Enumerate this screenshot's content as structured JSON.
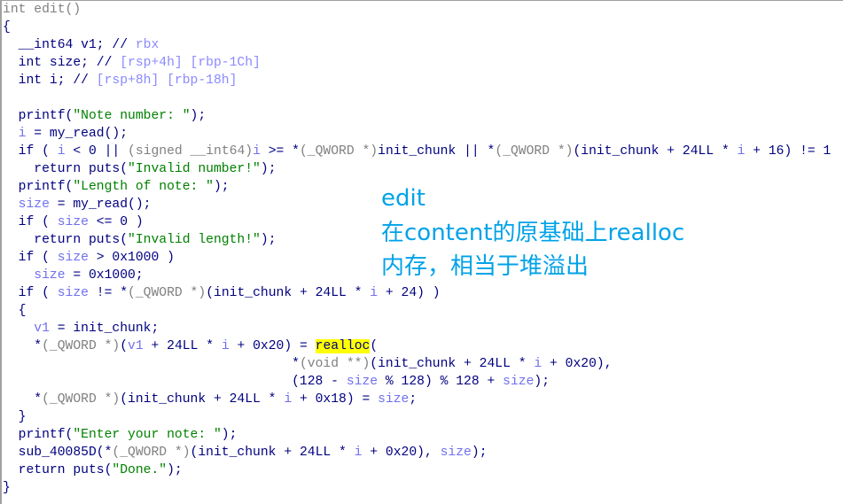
{
  "code_lines": [
    [
      [
        "g",
        "int edit()"
      ]
    ],
    [
      [
        "k",
        "{"
      ]
    ],
    [
      [
        "k",
        "  __int64 v1; // "
      ],
      [
        "c",
        "rbx"
      ]
    ],
    [
      [
        "k",
        "  int size; // "
      ],
      [
        "c",
        "[rsp+4h] [rbp-1Ch]"
      ]
    ],
    [
      [
        "k",
        "  int i; // "
      ],
      [
        "c",
        "[rsp+8h] [rbp-18h]"
      ]
    ],
    [],
    [
      [
        "k",
        "  printf("
      ],
      [
        "s",
        "\"Note number: \""
      ],
      [
        "k",
        ");"
      ]
    ],
    [
      [
        "k",
        "  "
      ],
      [
        "v",
        "i"
      ],
      [
        "k",
        " = my_read();"
      ]
    ],
    [
      [
        "k",
        "  if ( "
      ],
      [
        "v",
        "i"
      ],
      [
        "k",
        " < 0 || "
      ],
      [
        "g",
        "(signed __int64)"
      ],
      [
        "v",
        "i"
      ],
      [
        "k",
        " >= *"
      ],
      [
        "g",
        "(_QWORD *)"
      ],
      [
        "k",
        "init_chunk || *"
      ],
      [
        "g",
        "(_QWORD *)"
      ],
      [
        "k",
        "(init_chunk + 24LL * "
      ],
      [
        "v",
        "i"
      ],
      [
        "k",
        " + 16) != 1"
      ]
    ],
    [
      [
        "k",
        "    return puts("
      ],
      [
        "s",
        "\"Invalid number!\""
      ],
      [
        "k",
        ");"
      ]
    ],
    [
      [
        "k",
        "  printf("
      ],
      [
        "s",
        "\"Length of note: \""
      ],
      [
        "k",
        ");"
      ]
    ],
    [
      [
        "k",
        "  "
      ],
      [
        "v",
        "size"
      ],
      [
        "k",
        " = my_read();"
      ]
    ],
    [
      [
        "k",
        "  if ( "
      ],
      [
        "v",
        "size"
      ],
      [
        "k",
        " <= 0 )"
      ]
    ],
    [
      [
        "k",
        "    return puts("
      ],
      [
        "s",
        "\"Invalid length!\""
      ],
      [
        "k",
        ");"
      ]
    ],
    [
      [
        "k",
        "  if ( "
      ],
      [
        "v",
        "size"
      ],
      [
        "k",
        " > 0x1000 )"
      ]
    ],
    [
      [
        "k",
        "    "
      ],
      [
        "v",
        "size"
      ],
      [
        "k",
        " = 0x1000;"
      ]
    ],
    [
      [
        "k",
        "  if ( "
      ],
      [
        "v",
        "size"
      ],
      [
        "k",
        " != *"
      ],
      [
        "g",
        "(_QWORD *)"
      ],
      [
        "k",
        "(init_chunk + 24LL * "
      ],
      [
        "v",
        "i"
      ],
      [
        "k",
        " + 24) )"
      ]
    ],
    [
      [
        "k",
        "  {"
      ]
    ],
    [
      [
        "k",
        "    "
      ],
      [
        "v",
        "v1"
      ],
      [
        "k",
        " = init_chunk;"
      ]
    ],
    [
      [
        "k",
        "    *"
      ],
      [
        "g",
        "(_QWORD *)"
      ],
      [
        "k",
        "("
      ],
      [
        "v",
        "v1"
      ],
      [
        "k",
        " + 24LL * "
      ],
      [
        "v",
        "i"
      ],
      [
        "k",
        " + 0x20) = "
      ],
      [
        "h",
        "realloc"
      ],
      [
        "k",
        "("
      ]
    ],
    [
      [
        "k",
        "                                     *"
      ],
      [
        "g",
        "(void **)"
      ],
      [
        "k",
        "(init_chunk + 24LL * "
      ],
      [
        "v",
        "i"
      ],
      [
        "k",
        " + 0x20),"
      ]
    ],
    [
      [
        "k",
        "                                     (128 - "
      ],
      [
        "v",
        "size"
      ],
      [
        "k",
        " % 128) % 128 + "
      ],
      [
        "v",
        "size"
      ],
      [
        "k",
        ");"
      ]
    ],
    [
      [
        "k",
        "    *"
      ],
      [
        "g",
        "(_QWORD *)"
      ],
      [
        "k",
        "(init_chunk + 24LL * "
      ],
      [
        "v",
        "i"
      ],
      [
        "k",
        " + 0x18) = "
      ],
      [
        "v",
        "size"
      ],
      [
        "k",
        ";"
      ]
    ],
    [
      [
        "k",
        "  }"
      ]
    ],
    [
      [
        "k",
        "  printf("
      ],
      [
        "s",
        "\"Enter your note: \""
      ],
      [
        "k",
        ");"
      ]
    ],
    [
      [
        "k",
        "  sub_40085D(*"
      ],
      [
        "g",
        "(_QWORD *)"
      ],
      [
        "k",
        "(init_chunk + 24LL * "
      ],
      [
        "v",
        "i"
      ],
      [
        "k",
        " + 0x20), "
      ],
      [
        "v",
        "size"
      ],
      [
        "k",
        ");"
      ]
    ],
    [
      [
        "k",
        "  return puts("
      ],
      [
        "s",
        "\"Done.\""
      ],
      [
        "k",
        ");"
      ]
    ],
    [
      [
        "k",
        "}"
      ]
    ]
  ],
  "annotation": {
    "line1": "edit",
    "line2": "在content的原基础上realloc",
    "line3": "内存，相当于堆溢出"
  },
  "colors": {
    "annotation": "#00a2e8",
    "highlight": "#ffff00",
    "string": "#008000",
    "variable": "#7070f0",
    "code": "#000080",
    "type": "#808080"
  }
}
